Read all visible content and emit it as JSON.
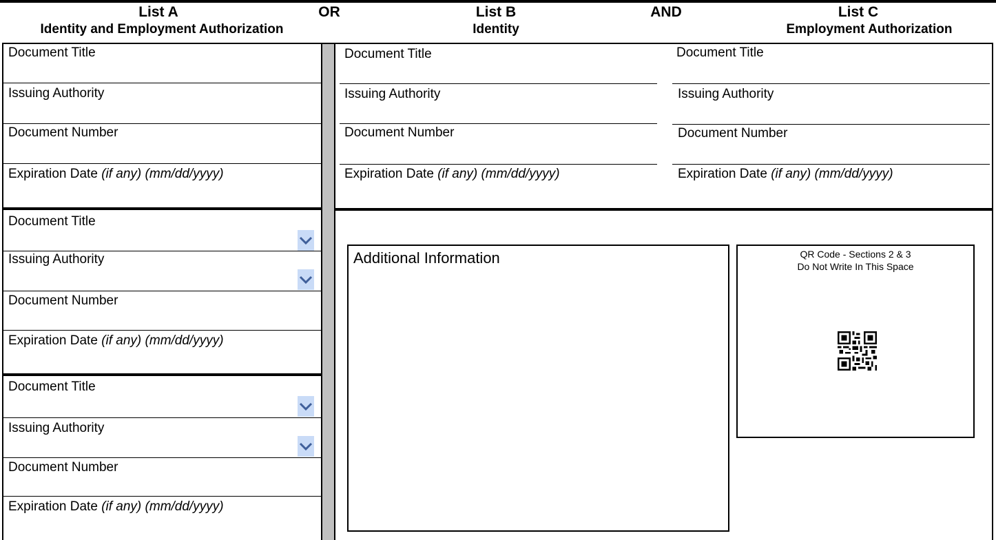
{
  "header": {
    "list_a_title": "List A",
    "list_a_sub": "Identity and Employment Authorization",
    "or": "OR",
    "list_b_title": "List B",
    "list_b_sub": "Identity",
    "and": "AND",
    "list_c_title": "List C",
    "list_c_sub": "Employment Authorization"
  },
  "labels": {
    "document_title": "Document Title",
    "issuing_authority": "Issuing Authority",
    "document_number": "Document Number",
    "expiration_date": "Expiration Date",
    "expiration_hint": "(if any) (mm/dd/yyyy)"
  },
  "additional_info": {
    "label": "Additional Information"
  },
  "qr": {
    "line1": "QR Code - Sections 2 & 3",
    "line2": "Do Not Write In This Space"
  },
  "icons": {
    "dropdown": "chevron-down-icon",
    "qr": "qr-code-icon"
  },
  "colors": {
    "dropdown_bg": "#c9dbf7",
    "chevron": "#3f5f9a",
    "divider_gray": "#c0c0c0"
  }
}
